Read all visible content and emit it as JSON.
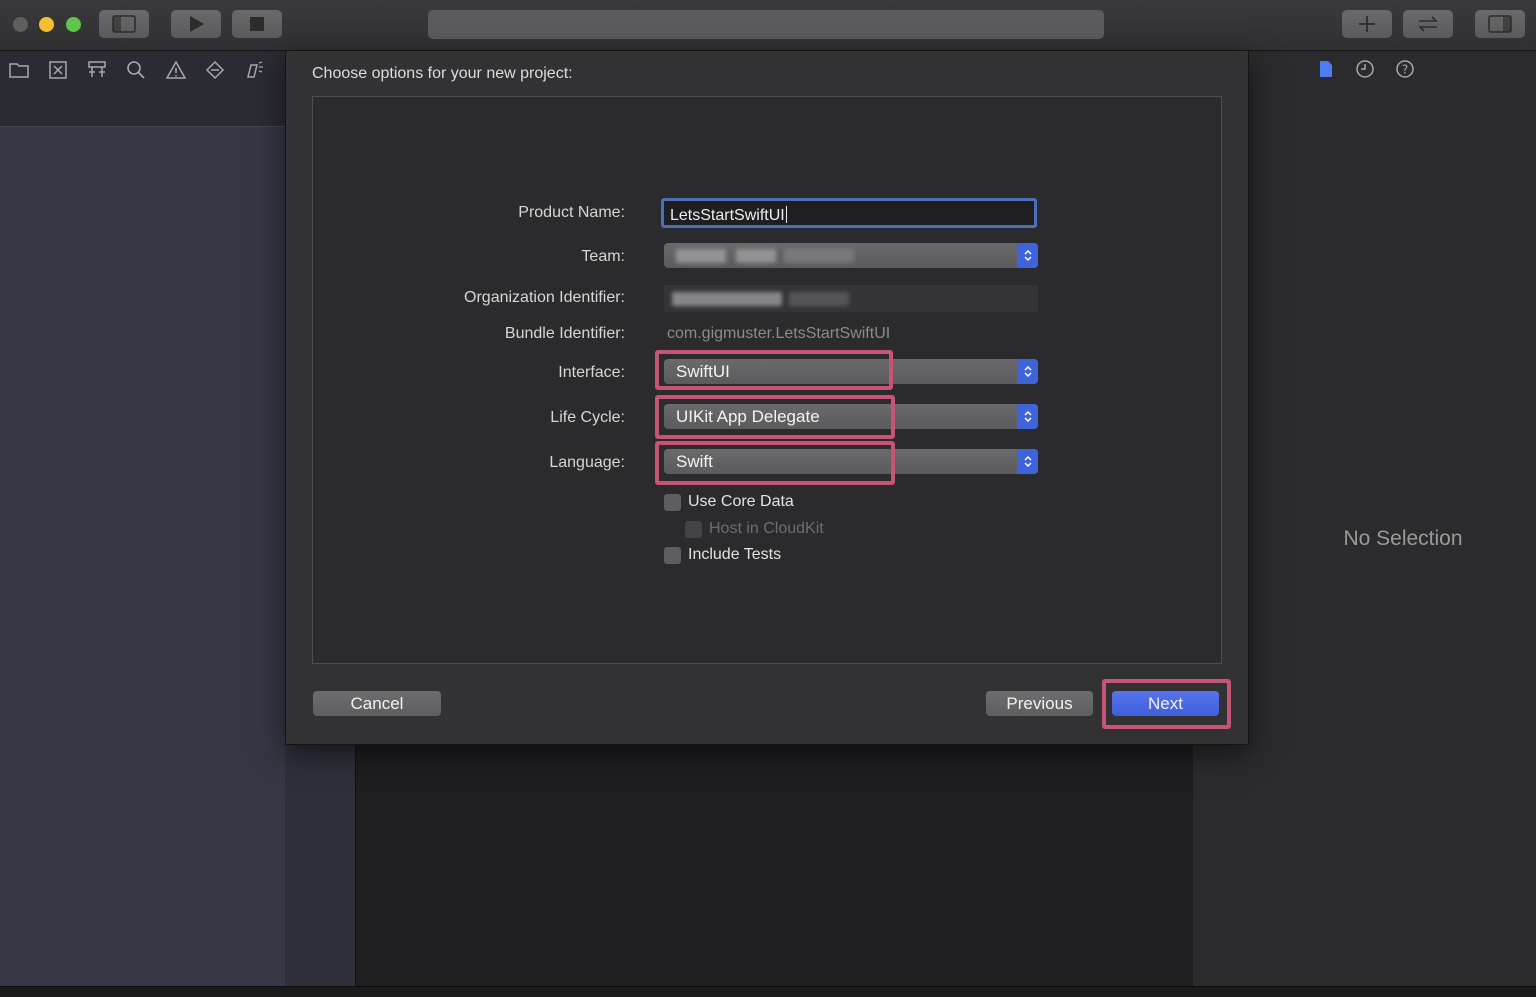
{
  "window": {
    "toolbar": {
      "run_button_icon": "play-icon",
      "stop_button_icon": "stop-icon",
      "library_button_icon": "plus-icon",
      "review_button_icon": "swap-arrows-icon",
      "inspector_toggle_icon": "sidebar-right-icon",
      "navigator_toggle_icon": "sidebar-left-icon"
    },
    "navigator_tabs": [
      "folder-icon",
      "source-control-icon",
      "hierarchy-icon",
      "search-icon",
      "warning-icon",
      "test-diamond-icon",
      "debug-icon"
    ],
    "inspector_tabs": [
      "file-icon",
      "history-icon",
      "help-icon"
    ],
    "inspector": {
      "empty_label": "No Selection"
    }
  },
  "sheet": {
    "title": "Choose options for your new project:",
    "fields": {
      "product_name": {
        "label": "Product Name:",
        "value": "LetsStartSwiftUI"
      },
      "team": {
        "label": "Team:",
        "value": ""
      },
      "organization_identifier": {
        "label": "Organization Identifier:",
        "value": ""
      },
      "bundle_identifier": {
        "label": "Bundle Identifier:",
        "value": "com.gigmuster.LetsStartSwiftUI"
      },
      "interface": {
        "label": "Interface:",
        "value": "SwiftUI"
      },
      "life_cycle": {
        "label": "Life Cycle:",
        "value": "UIKit App Delegate"
      },
      "language": {
        "label": "Language:",
        "value": "Swift"
      }
    },
    "checkboxes": {
      "use_core_data": {
        "label": "Use Core Data",
        "checked": false,
        "enabled": true
      },
      "host_in_cloudkit": {
        "label": "Host in CloudKit",
        "checked": false,
        "enabled": false
      },
      "include_tests": {
        "label": "Include Tests",
        "checked": false,
        "enabled": true
      }
    },
    "buttons": {
      "cancel": "Cancel",
      "previous": "Previous",
      "next": "Next"
    }
  },
  "colors": {
    "accent": "#3f5ed8",
    "highlight_annotation": "#c55475",
    "traffic_close": "#5f5f5f",
    "traffic_minimize": "#f5bf2f",
    "traffic_zoom": "#5fc54c"
  }
}
